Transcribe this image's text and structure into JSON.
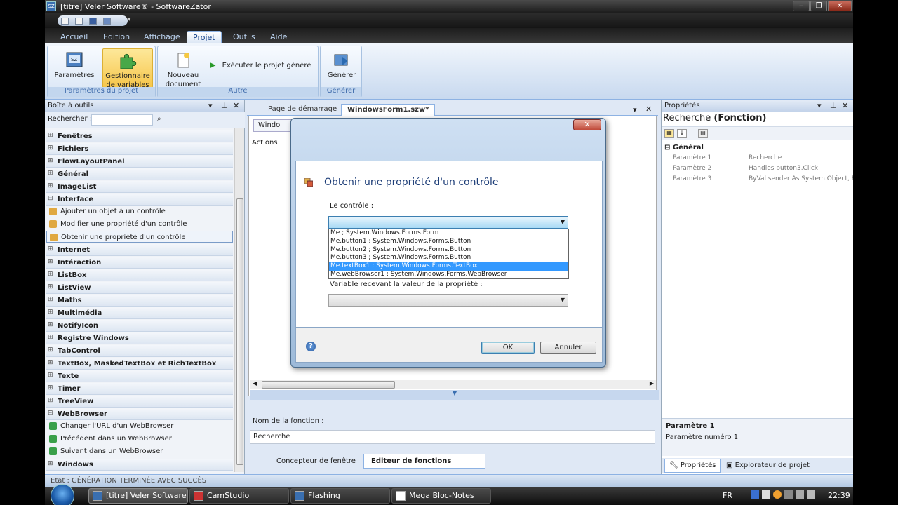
{
  "window": {
    "title": "[titre] Veler Software® - SoftwareZator",
    "controls": [
      "‒",
      "❐",
      "✕"
    ]
  },
  "ribbon": {
    "tabs": [
      "Accueil",
      "Edition",
      "Affichage",
      "Projet",
      "Outils",
      "Aide"
    ],
    "active_tab": "Projet",
    "groups": {
      "params": {
        "label": "Paramètres du projet",
        "btn_params": "Paramètres",
        "btn_vars_1": "Gestionnaire",
        "btn_vars_2": "de variables"
      },
      "other": {
        "label": "Autre",
        "btn_newdoc_1": "Nouveau",
        "btn_newdoc_2": "document",
        "btn_run": "Exécuter le projet généré"
      },
      "generate": {
        "label": "Générer",
        "btn_generate": "Générer"
      }
    }
  },
  "toolbox": {
    "title": "Boîte à outils",
    "search_label": "Rechercher :",
    "items": [
      {
        "label": "Fenêtres",
        "type": "cat"
      },
      {
        "label": "Fichiers",
        "type": "cat"
      },
      {
        "label": "FlowLayoutPanel",
        "type": "cat"
      },
      {
        "label": "Général",
        "type": "cat"
      },
      {
        "label": "ImageList",
        "type": "cat"
      },
      {
        "label": "Interface",
        "type": "cat-open"
      },
      {
        "label": "Ajouter un objet à un contrôle",
        "type": "sub"
      },
      {
        "label": "Modifier une propriété d'un contrôle",
        "type": "sub"
      },
      {
        "label": "Obtenir une propriété d'un contrôle",
        "type": "sub-sel"
      },
      {
        "label": "Internet",
        "type": "cat"
      },
      {
        "label": "Intéraction",
        "type": "cat"
      },
      {
        "label": "ListBox",
        "type": "cat"
      },
      {
        "label": "ListView",
        "type": "cat"
      },
      {
        "label": "Maths",
        "type": "cat"
      },
      {
        "label": "Multimédia",
        "type": "cat"
      },
      {
        "label": "NotifyIcon",
        "type": "cat"
      },
      {
        "label": "Registre Windows",
        "type": "cat"
      },
      {
        "label": "TabControl",
        "type": "cat"
      },
      {
        "label": "TextBox, MaskedTextBox et RichTextBox",
        "type": "cat"
      },
      {
        "label": "Texte",
        "type": "cat"
      },
      {
        "label": "Timer",
        "type": "cat"
      },
      {
        "label": "TreeView",
        "type": "cat"
      },
      {
        "label": "WebBrowser",
        "type": "cat-open"
      },
      {
        "label": "Changer l'URL d'un WebBrowser",
        "type": "sub"
      },
      {
        "label": "Précédent dans un WebBrowser",
        "type": "sub"
      },
      {
        "label": "Suivant dans un WebBrowser",
        "type": "sub"
      },
      {
        "label": "Windows",
        "type": "cat"
      }
    ]
  },
  "document": {
    "tabs": [
      "Page de démarrage",
      "WindowsForm1.szw*"
    ],
    "inner_tab": "Windo",
    "actions_label": "Actions",
    "function_name_label": "Nom de la fonction :",
    "function_name_value": "Recherche",
    "bottom_tabs": [
      "Concepteur de fenêtre",
      "Editeur de fonctions"
    ]
  },
  "properties": {
    "title": "Propriétés",
    "object_name": "Recherche",
    "object_type": "(Fonction)",
    "category": "Général",
    "rows": [
      {
        "key": "Paramètre 1",
        "value": "Recherche"
      },
      {
        "key": "Paramètre 2",
        "value": "Handles button3.Click"
      },
      {
        "key": "Paramètre 3",
        "value": "ByVal sender As System.Object, B"
      }
    ],
    "desc_title": "Paramètre 1",
    "desc_text": "Paramètre numéro 1",
    "tabs": [
      "Propriétés",
      "Explorateur de projet"
    ]
  },
  "dialog": {
    "heading": "Obtenir une propriété d'un contrôle",
    "control_label": "Le contrôle :",
    "options": [
      "Me ; System.Windows.Forms.Form",
      "Me.button1 ; System.Windows.Forms.Button",
      "Me.button2 ; System.Windows.Forms.Button",
      "Me.button3 ; System.Windows.Forms.Button",
      "Me.textBox1 ; System.Windows.Forms.TextBox",
      "Me.webBrowser1 ; System.Windows.Forms.WebBrowser"
    ],
    "selected_index": 4,
    "variable_label": "Variable recevant la valeur de la propriété :",
    "ok": "OK",
    "cancel": "Annuler",
    "close_glyph": "✕",
    "help_glyph": "?"
  },
  "status": {
    "text": "Etat : GÉNÉRATION TERMINÉE AVEC SUCCÈS"
  },
  "taskbar": {
    "buttons": [
      "[titre] Veler Software...",
      "CamStudio",
      "Flashing",
      "Mega Bloc-Notes"
    ],
    "lang": "FR",
    "time": "22:39"
  }
}
